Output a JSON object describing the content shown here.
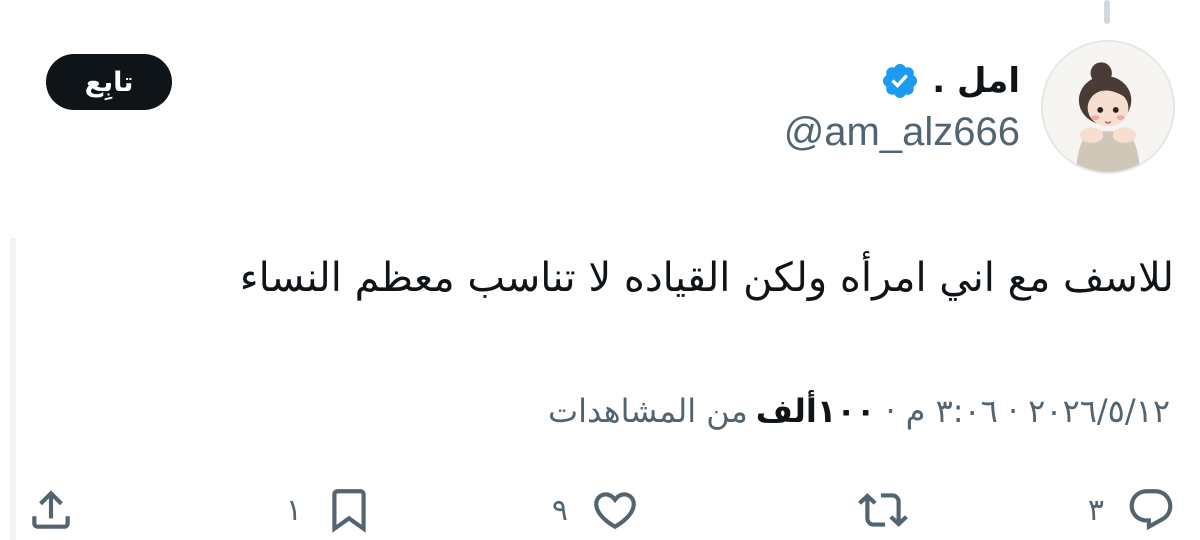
{
  "author": {
    "display_name": "امل .",
    "handle": "@am_alz666",
    "verified": true
  },
  "follow_label": "تابِع",
  "tweet": {
    "text": "للاسف مع اني امرأه ولكن القياده لا تناسب معظم النساء"
  },
  "meta": {
    "date": "٢٠٢٦/٥/١٢",
    "separator": "·",
    "time": "٣:٠٦ م",
    "views_count": "١٠٠ألف",
    "views_label": "من المشاهدات"
  },
  "actions": {
    "reply_count": "٣",
    "retweet_count": "",
    "like_count": "٩",
    "bookmark_count": "١"
  },
  "colors": {
    "verified": "#1d9bf0",
    "text_primary": "#0f1419",
    "text_secondary": "#536471",
    "button_bg": "#0f1419"
  },
  "icons": [
    "verified-badge-icon",
    "reply-icon",
    "retweet-icon",
    "like-icon",
    "bookmark-icon",
    "share-icon"
  ]
}
